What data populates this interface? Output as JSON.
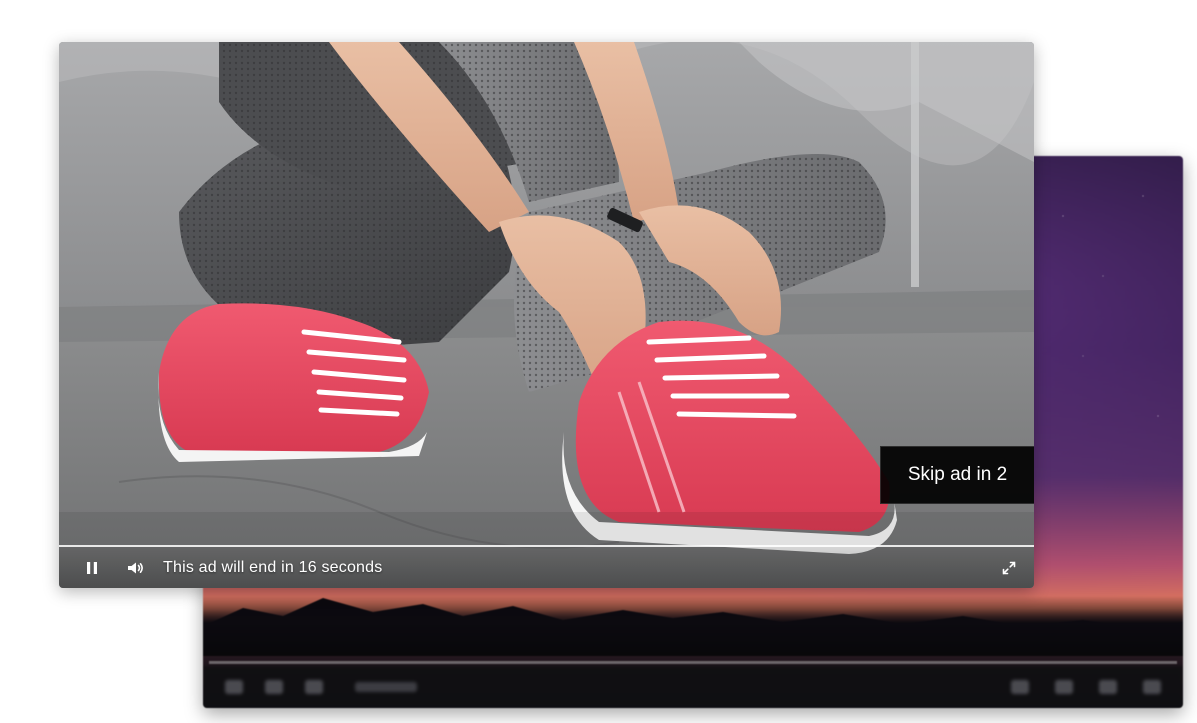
{
  "ad_player": {
    "skip_button_label": "Skip ad in 2",
    "ad_end_message": "This ad will end in 16 seconds",
    "controls": {
      "pause_icon": "pause-icon",
      "volume_icon": "volume-icon",
      "fullscreen_icon": "fullscreen-icon"
    },
    "accent_color": "#e8455f"
  },
  "background_player": {
    "controls": {
      "icons": [
        "play-icon",
        "next-icon",
        "volume-icon",
        "settings-icon",
        "share-icon",
        "cast-icon",
        "fullscreen-icon"
      ]
    }
  }
}
